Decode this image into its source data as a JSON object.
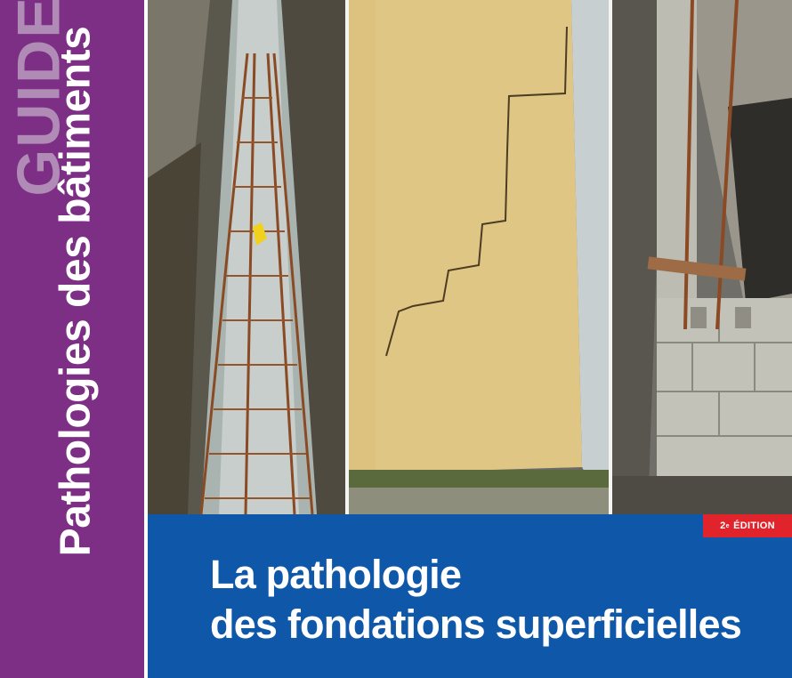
{
  "spine": {
    "guide_label": "GUIDE",
    "series_title": "Pathologies des bâtiments"
  },
  "photos": [
    {
      "name": "foundation-trench-rebar-photo"
    },
    {
      "name": "cracked-rendered-wall-photo"
    },
    {
      "name": "concrete-block-foundation-photo"
    }
  ],
  "band": {
    "edition_number": "2",
    "edition_suffix": "e",
    "edition_word": " ÉDITION",
    "title_line1": "La pathologie",
    "title_line2": "des fondations superficielles"
  },
  "colors": {
    "spine_purple": "#7d2f86",
    "band_blue": "#0f57a8",
    "edition_red": "#e1242b"
  }
}
